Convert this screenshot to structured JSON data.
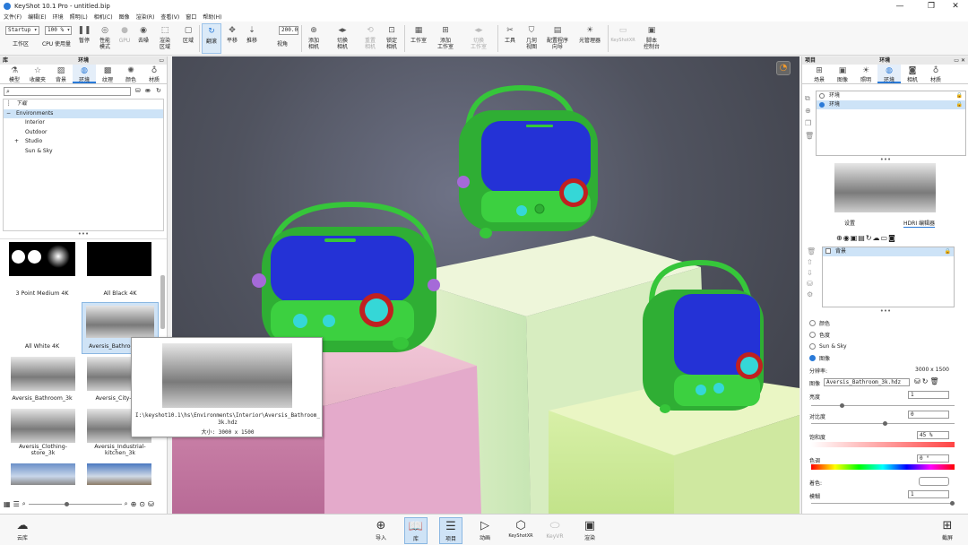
{
  "titlebar": {
    "title": "KeyShot 10.1 Pro  - untitled.bip",
    "min": "—",
    "max": "❐",
    "close": "✕"
  },
  "menu": [
    "文件(F)",
    "编辑(E)",
    "环境",
    "照明(L)",
    "相机(C)",
    "图像",
    "渲染(R)",
    "查看(V)",
    "窗口",
    "帮助(H)"
  ],
  "toolbar": {
    "workspace": "Startup",
    "zoom": "100 %",
    "num": "200.0",
    "items": [
      {
        "label": "工作区",
        "icon": "monitor-icon"
      },
      {
        "label": "CPU 使用量",
        "icon": "cpu-icon"
      },
      {
        "label": "暂停",
        "icon": "pause-icon"
      },
      {
        "label": "性能\n模式",
        "icon": "performance-icon"
      },
      {
        "label": "GPU",
        "icon": "gpu-icon"
      },
      {
        "label": "去噪",
        "icon": "denoise-icon"
      },
      {
        "label": "渲染\n区域",
        "icon": "render-region-icon"
      },
      {
        "label": "区域",
        "icon": "region-icon"
      },
      {
        "label": "翻滚",
        "icon": "tumble-icon"
      },
      {
        "label": "平移",
        "icon": "pan-icon"
      },
      {
        "label": "推移",
        "icon": "dolly-icon"
      },
      {
        "label": "视角",
        "icon": "fov-icon"
      },
      {
        "label": "添加\n相机",
        "icon": "add-camera-icon"
      },
      {
        "label": "切换\n相机",
        "icon": "switch-camera-icon"
      },
      {
        "label": "重置\n相机",
        "icon": "reset-camera-icon"
      },
      {
        "label": "锁定\n相机",
        "icon": "lock-camera-icon"
      },
      {
        "label": "工作室",
        "icon": "studio-icon"
      },
      {
        "label": "添加\n工作室",
        "icon": "add-studio-icon"
      },
      {
        "label": "切换\n工作室",
        "icon": "switch-studio-icon"
      },
      {
        "label": "工具",
        "icon": "tools-icon"
      },
      {
        "label": "几何\n视图",
        "icon": "geometry-view-icon"
      },
      {
        "label": "配置程序\n向导",
        "icon": "configurator-icon"
      },
      {
        "label": "光管理器",
        "icon": "light-manager-icon"
      },
      {
        "label": "KeyShotXR",
        "icon": "xr-icon"
      },
      {
        "label": "脚本\n控制台",
        "icon": "script-icon"
      }
    ]
  },
  "left": {
    "header": "库",
    "tab_header": "环境",
    "tabs": [
      {
        "label": "模型"
      },
      {
        "label": "收藏夹"
      },
      {
        "label": "背景"
      },
      {
        "label": "环境"
      },
      {
        "label": "纹理"
      },
      {
        "label": "颜色"
      },
      {
        "label": "材质"
      }
    ],
    "tree": [
      "下载",
      "Environments",
      "Interior",
      "Outdoor",
      "Studio",
      "Sun & Sky"
    ],
    "thumbs": [
      "3 Point Medium 4K",
      "All Black 4K",
      "All White 4K",
      "Aversis_Bathroom_3k",
      "Aversis_Bathroom_3k",
      "Aversis_City-alley",
      "Aversis_Clothing-store_3k",
      "Aversis_Industrial-kitchen_3k"
    ],
    "tooltip": {
      "path": "I:\\keyshot10.1\\hs\\Environments\\Interior\\Aversis_Bathroom_3k.hdz",
      "size": "大小: 3000 x 1500"
    }
  },
  "right": {
    "header": "项目",
    "tab_header": "环境",
    "tabs": [
      {
        "label": "场景"
      },
      {
        "label": "图像"
      },
      {
        "label": "照明"
      },
      {
        "label": "环境"
      },
      {
        "label": "相机"
      },
      {
        "label": "材质"
      }
    ],
    "envlist": [
      "环境",
      "环境"
    ],
    "subtabs": [
      "设置",
      "HDRI 编辑器"
    ],
    "layer": "背景",
    "radios": [
      "颜色",
      "色度",
      "Sun & Sky",
      "图像"
    ],
    "resolution_label": "分辨率:",
    "resolution": "3000 x 1500",
    "image_label": "图像",
    "image_file": "Aversis_Bathroom_3k.hdz",
    "brightness_label": "亮度",
    "brightness": "1",
    "contrast_label": "对比度",
    "contrast": "0",
    "saturation_label": "饱和度",
    "saturation": "45 %",
    "hue_label": "色调",
    "hue": "0 °",
    "tint_label": "着色:",
    "blur_label": "模糊",
    "blur": "1"
  },
  "bottom": [
    {
      "label": "云库"
    },
    {
      "label": "导入"
    },
    {
      "label": "库"
    },
    {
      "label": "项目"
    },
    {
      "label": "动画"
    },
    {
      "label": "KeyShotXR"
    },
    {
      "label": "KeyVR"
    },
    {
      "label": "渲染"
    },
    {
      "label": "截屏"
    }
  ],
  "colors": {
    "accent": "#2a7ad8",
    "radio_green": "#36c63a",
    "radio_blue": "#2432d6"
  }
}
